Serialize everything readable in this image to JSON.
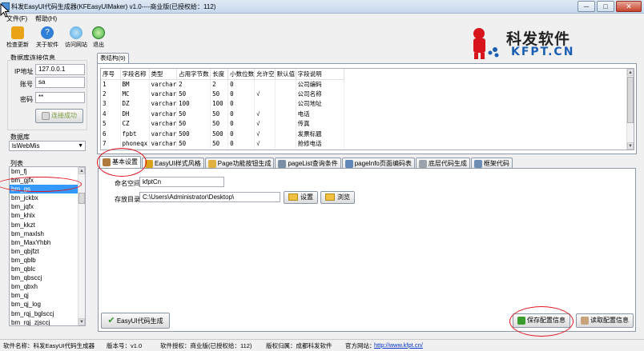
{
  "window": {
    "title": "科发EasyUI代码生成器(KFEasyUIMaker) v1.0----商业版(已授权给：112)",
    "minimize": "─",
    "maximize": "□",
    "close": "✕"
  },
  "menu": [
    {
      "label": "文件(F)"
    },
    {
      "label": "帮助(H)"
    }
  ],
  "toolbar": [
    {
      "label": "检查更新",
      "icon": "update-icon",
      "color": "#e8a317"
    },
    {
      "label": "关于软件",
      "icon": "help-icon",
      "color": "#2f7fd6"
    },
    {
      "label": "访问网站",
      "icon": "globe-icon",
      "color": "#4aa3df"
    },
    {
      "label": "退出",
      "icon": "exit-icon",
      "color": "#3fae3f"
    }
  ],
  "logo": {
    "name": "科发软件",
    "site": "KFPT.CN"
  },
  "connection": {
    "group_label": "数据库连接信息",
    "ip_label": "IP地址",
    "ip_value": "127.0.0.1",
    "user_label": "账号",
    "user_value": "sa",
    "pwd_label": "密码",
    "pwd_value": "**",
    "connect_button": "连接成功"
  },
  "database": {
    "label": "数据库",
    "selected": "lsWebMis"
  },
  "tables": {
    "label": "列表",
    "items": [
      "bm_fj",
      "bm_gjfx",
      "bm_gs",
      "bm_jckbx",
      "bm_jqfx",
      "bm_khlx",
      "bm_kkzt",
      "bm_maxlsh",
      "bm_MaxYhbh",
      "bm_qbjfzt",
      "bm_qblb",
      "bm_qblc",
      "bm_qbsccj",
      "bm_qbxh",
      "bm_qj",
      "bm_qj_log",
      "bm_rqj_bglsccj",
      "bm_rqj_zjsccj",
      "bm_search"
    ],
    "selected_index": 2
  },
  "structure": {
    "tab_label": "表结构(9)",
    "columns": [
      "序号",
      "字段名称",
      "类型",
      "占用字节数",
      "长度",
      "小数位数",
      "允许空",
      "默认值",
      "字段说明"
    ],
    "rows": [
      [
        "1",
        "BM",
        "varchar",
        "2",
        "2",
        "0",
        "",
        "",
        "公司编码"
      ],
      [
        "2",
        "MC",
        "varchar",
        "50",
        "50",
        "0",
        "√",
        "",
        "公司名称"
      ],
      [
        "3",
        "DZ",
        "varchar",
        "100",
        "100",
        "0",
        "",
        "",
        "公司地址"
      ],
      [
        "4",
        "DH",
        "varchar",
        "50",
        "50",
        "0",
        "√",
        "",
        "电话"
      ],
      [
        "5",
        "CZ",
        "varchar",
        "50",
        "50",
        "0",
        "√",
        "",
        "传真"
      ],
      [
        "6",
        "fpbt",
        "varchar",
        "500",
        "500",
        "0",
        "√",
        "",
        "发票标题"
      ],
      [
        "7",
        "phoneqx",
        "varchar",
        "50",
        "50",
        "0",
        "√",
        "",
        "抢修电话"
      ]
    ]
  },
  "config_tabs": [
    {
      "label": "基本设置",
      "color": "#b07a3c"
    },
    {
      "label": "EasyUI样式风格",
      "color": "#d9a21b"
    },
    {
      "label": "Page功能按钮生成",
      "color": "#e0b040"
    },
    {
      "label": "pageList查询条件",
      "color": "#7a8ea6"
    },
    {
      "label": "pageInfo页面编码表",
      "color": "#5f88b8"
    },
    {
      "label": "底层代码生成",
      "color": "#9aa2ab"
    },
    {
      "label": "框架代码",
      "color": "#6d8fb5"
    }
  ],
  "basic": {
    "namespace_label": "命名空间",
    "namespace_value": "kfptCn",
    "path_label": "存放目录",
    "path_value": "C:\\Users\\Administrator\\Desktop\\",
    "settings_button": "设置",
    "browse_button": "浏览"
  },
  "actions": {
    "generate": "EasyUI代码生成",
    "save": "保存配置信息",
    "load": "读取配置信息"
  },
  "status": {
    "software_name": "软件名称：科发EasyUI代码生成器",
    "version": "版本号：v1.0",
    "license": "软件授权：商业版(已授权给：112)",
    "copyright": "版权归属：成都科发软件",
    "website_label": "官方网站：",
    "website": "http://www.kfpt.cn/"
  },
  "colors": {
    "accent_red": "#e0141e",
    "selection": "#3399ff",
    "logo_red": "#d8141c",
    "logo_blue": "#1a5fb4"
  }
}
